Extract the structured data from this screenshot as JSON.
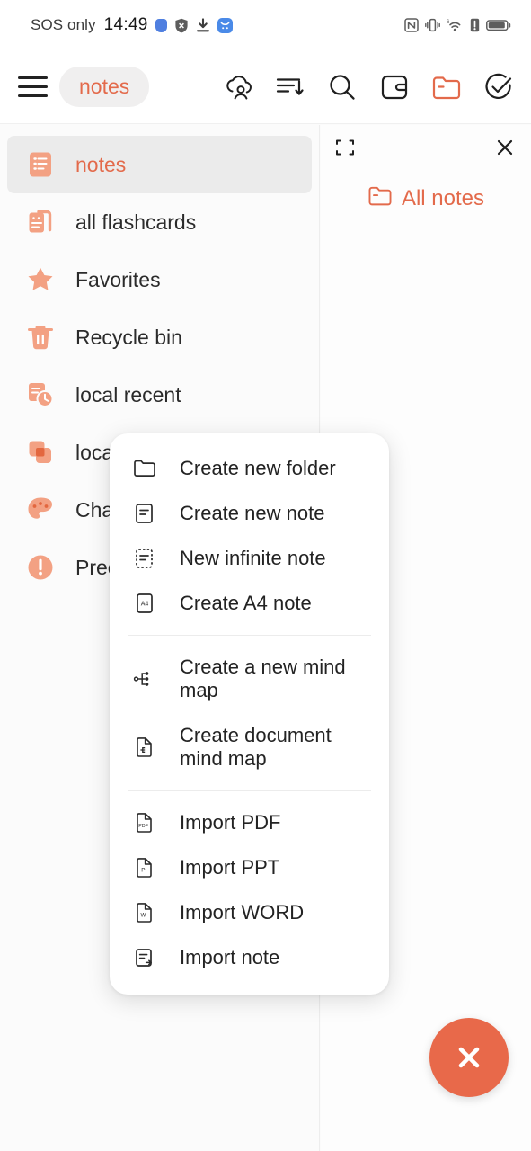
{
  "status_bar": {
    "carrier": "SOS only",
    "time": "14:49",
    "left_icons": [
      "blue-shield-icon",
      "blocked-shield-icon",
      "download-icon",
      "app-badge-icon"
    ],
    "right_icons": [
      "nfc-icon",
      "vibrate-icon",
      "wifi6-icon",
      "alert-icon",
      "battery-icon"
    ]
  },
  "appbar": {
    "menu_icon": "hamburger-menu-icon",
    "title": "notes",
    "actions": [
      {
        "name": "cloud-account-icon",
        "label": "cloud account"
      },
      {
        "name": "sort-icon",
        "label": "sort"
      },
      {
        "name": "search-icon",
        "label": "search"
      },
      {
        "name": "panel-toggle-icon",
        "label": "panel"
      },
      {
        "name": "folder-icon",
        "label": "folder",
        "active": true
      },
      {
        "name": "check-circle-icon",
        "label": "select"
      }
    ]
  },
  "sidebar": {
    "items": [
      {
        "label": "notes",
        "icon": "note-list-icon",
        "active": true
      },
      {
        "label": "all flashcards",
        "icon": "flashcards-icon",
        "active": false
      },
      {
        "label": "Favorites",
        "icon": "star-icon",
        "active": false
      },
      {
        "label": "Recycle bin",
        "icon": "trash-icon",
        "active": false
      },
      {
        "label": "local recent",
        "icon": "clock-history-icon",
        "active": false
      },
      {
        "label": "local notes",
        "icon": "stacked-squares-icon",
        "active": false
      },
      {
        "label": "Charts",
        "icon": "palette-icon",
        "active": false
      },
      {
        "label": "Precautions",
        "icon": "exclamation-circle-icon",
        "active": false
      }
    ]
  },
  "right_pane": {
    "collapse_icon": "collapse-icon",
    "close_icon": "close-icon",
    "title": "All notes",
    "title_icon": "folder-icon"
  },
  "fab": {
    "icon": "close-icon",
    "label": "close"
  },
  "menu": {
    "groups": [
      {
        "items": [
          {
            "label": "Create new folder",
            "icon": "folder-outline-icon"
          },
          {
            "label": "Create new note",
            "icon": "note-outline-icon"
          },
          {
            "label": "New infinite note",
            "icon": "infinite-note-icon"
          },
          {
            "label": "Create A4 note",
            "icon": "a4-note-icon"
          }
        ]
      },
      {
        "items": [
          {
            "label": "Create a new mind map",
            "icon": "mindmap-icon"
          },
          {
            "label": "Create document mind map",
            "icon": "document-mindmap-icon"
          }
        ]
      },
      {
        "items": [
          {
            "label": "Import PDF",
            "icon": "pdf-file-icon"
          },
          {
            "label": "Import PPT",
            "icon": "ppt-file-icon"
          },
          {
            "label": "Import WORD",
            "icon": "word-file-icon"
          },
          {
            "label": "Import note",
            "icon": "import-note-icon"
          }
        ]
      }
    ]
  },
  "colors": {
    "accent": "#e36a4b",
    "fab": "#e8694a",
    "icon_salmon": "#f0a083",
    "text": "#232323"
  }
}
